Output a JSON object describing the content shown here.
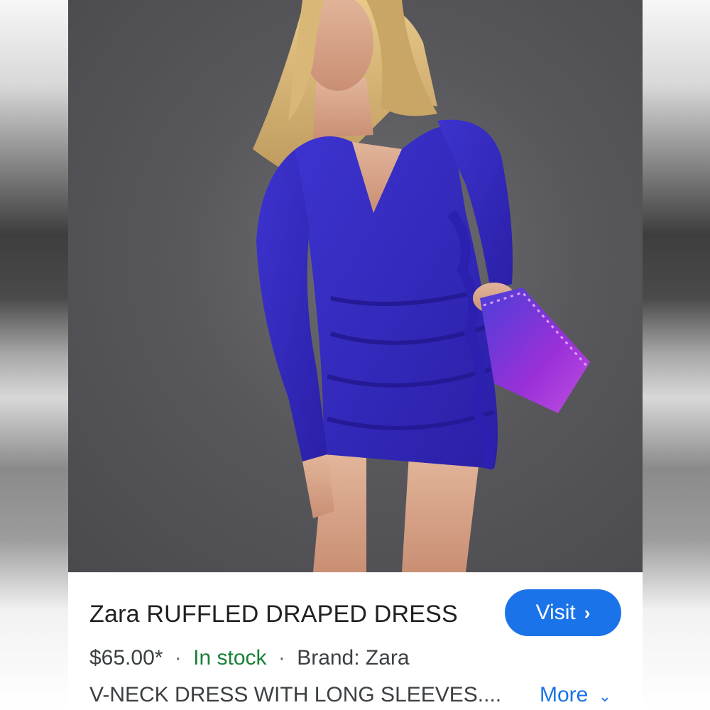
{
  "product": {
    "title": "Zara RUFFLED DRAPED DRESS",
    "price": "$65.00*",
    "separator": "·",
    "availability": "In stock",
    "brand": "Brand: Zara",
    "description": "V-NECK DRESS WITH LONG SLEEVES....",
    "more_label": "More"
  },
  "actions": {
    "visit_label": "Visit",
    "visit_icon": "chevron-right-icon",
    "more_icon": "chevron-down-icon"
  },
  "colors": {
    "accent": "#1a73e8",
    "in_stock": "#188038",
    "dress": "#3a2ec4",
    "clutch": "#8a2be2"
  }
}
